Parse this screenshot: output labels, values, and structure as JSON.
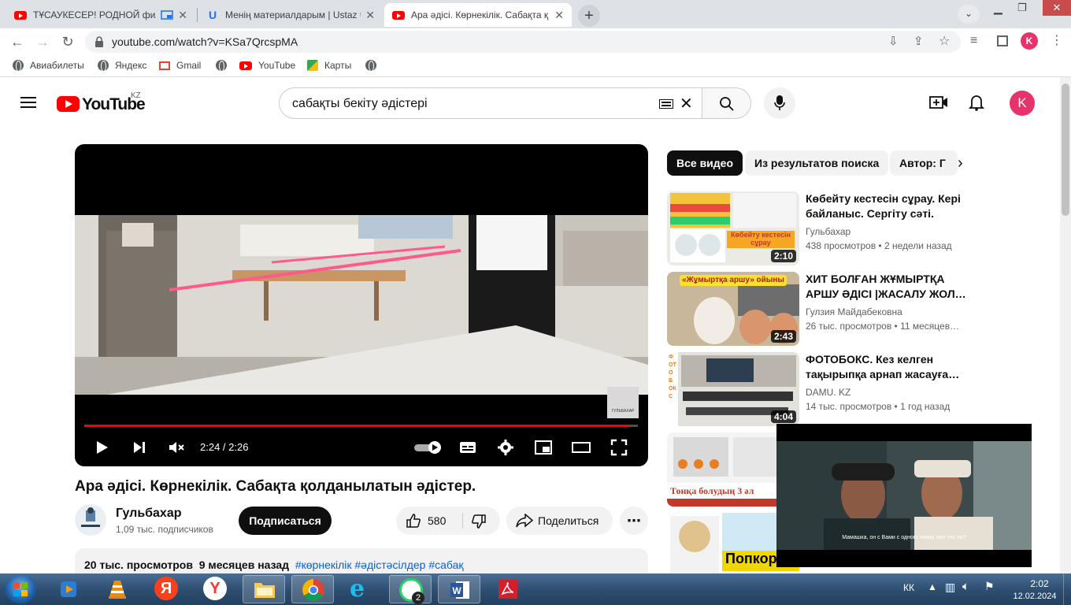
{
  "browser": {
    "tabs": [
      {
        "title": "ТҰСАУКЕСЕР! РОДНОЙ фил",
        "icon": "youtube-icon"
      },
      {
        "title": "Менің материалдарым | Ustaz tu",
        "icon": "ustaz-icon"
      },
      {
        "title": "Ара әдісі. Көрнекілік. Сабақта қ",
        "icon": "youtube-icon"
      }
    ],
    "url": "youtube.com/watch?v=KSa7QrcspMA",
    "profile_initial": "K",
    "bookmarks": [
      {
        "label": "Авиабилеты",
        "icon": "globe-icon"
      },
      {
        "label": "Яндекс",
        "icon": "globe-icon"
      },
      {
        "label": "Gmail",
        "icon": "gmail-icon"
      },
      {
        "label": "",
        "icon": "globe-icon"
      },
      {
        "label": "YouTube",
        "icon": "youtube-icon"
      },
      {
        "label": "Карты",
        "icon": "maps-icon"
      },
      {
        "label": "",
        "icon": "globe-icon"
      }
    ]
  },
  "youtube": {
    "logo_region": "KZ",
    "search_query": "сабақты бекіту әдістері",
    "avatar_initial": "K"
  },
  "player": {
    "time": "2:24 / 2:26",
    "progress": 0.985,
    "watermark": "ГУЛЬБАХАР"
  },
  "video": {
    "title": "Ара әдісі. Көрнекілік. Сабақта қолданылатын әдістер.",
    "channel": "Гульбахар",
    "subscribers": "1,09 тыс. подписчиков",
    "subscribe_label": "Подписаться",
    "likes": "580",
    "share_label": "Поделиться",
    "views": "20 тыс. просмотров",
    "age": "9 месяцев назад",
    "tags": "#көрнекілік #әдістәсілдер #сабақ"
  },
  "chips": [
    "Все видео",
    "Из результатов поиска",
    "Автор: Г"
  ],
  "recommendations": [
    {
      "title": "Көбейту кестесін сұрау. Кері байланыс. Сергіту сәті.",
      "channel": "Гульбахар",
      "meta": "438 просмотров • 2 недели назад",
      "duration": "2:10",
      "thumb_text": "Көбейту кестесін сұрау"
    },
    {
      "title": "ХИТ БОЛҒАН ЖҰМЫРТҚА АРШУ ӘДІСІ |ЖАСАЛУ ЖОЛ…",
      "channel": "Гулзия Майдабековна",
      "meta": "26 тыс. просмотров • 11 месяцев…",
      "duration": "2:43",
      "thumb_text": "«Жұмыртқа аршу» ойыны"
    },
    {
      "title": "ФОТОБОКС. Кез келген тақырыпқа арнап жасауға…",
      "channel": "DAMU. KZ",
      "meta": "14 тыс. просмотров • 1 год назад",
      "duration": "4:04",
      "thumb_text": "ФОТОБОКС"
    },
    {
      "title": "",
      "channel": "",
      "meta": "",
      "duration": "",
      "thumb_text": "Тонқа болудың 3 әл"
    },
    {
      "title": "",
      "channel": "",
      "meta": "",
      "duration": "",
      "thumb_text": "Попкор"
    }
  ],
  "mini_player": {
    "subtitle": "Мамашка, он с Вами с одного пивка пил что ли?"
  },
  "taskbar": {
    "lang": "КК",
    "time": "2:02",
    "date": "12.02.2024",
    "apps": [
      "start-orb",
      "media-player-icon",
      "vlc-icon",
      "yandex-icon",
      "yandex-browser-icon",
      "file-explorer-icon",
      "chrome-icon",
      "internet-explorer-icon",
      "whatsapp-icon",
      "word-icon",
      "acrobat-icon"
    ],
    "whatsapp_badge": "2"
  },
  "colors": {
    "youtube_red": "#ff0000",
    "avatar_pink": "#e7336b",
    "link_blue": "#065fd4",
    "taskbar": "#2f4f73"
  }
}
